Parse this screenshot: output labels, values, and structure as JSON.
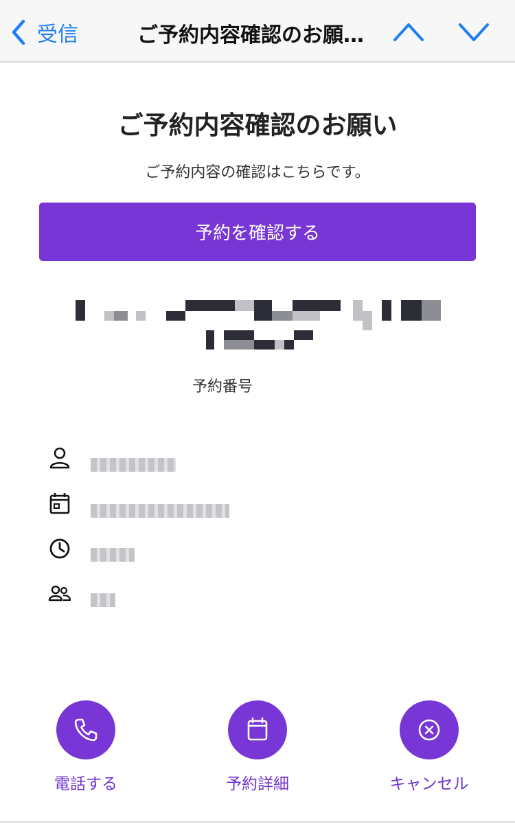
{
  "nav": {
    "back_label": "受信",
    "title": "ご予約内容確認のお願…"
  },
  "email": {
    "title": "ご予約内容確認のお願い",
    "subtitle": "ご予約内容の確認はこちらです。",
    "confirm_button": "予約を確認する",
    "reservation_number_label": "予約番号"
  },
  "details": [
    {
      "icon": "person-icon"
    },
    {
      "icon": "calendar-icon"
    },
    {
      "icon": "clock-icon"
    },
    {
      "icon": "people-icon"
    }
  ],
  "actions": [
    {
      "label": "電話する",
      "icon": "phone-icon"
    },
    {
      "label": "予約詳細",
      "icon": "calendar-icon"
    },
    {
      "label": "キャンセル",
      "icon": "cancel-icon"
    }
  ],
  "colors": {
    "accent": "#7836d6",
    "ios_blue": "#1f7ef5"
  }
}
